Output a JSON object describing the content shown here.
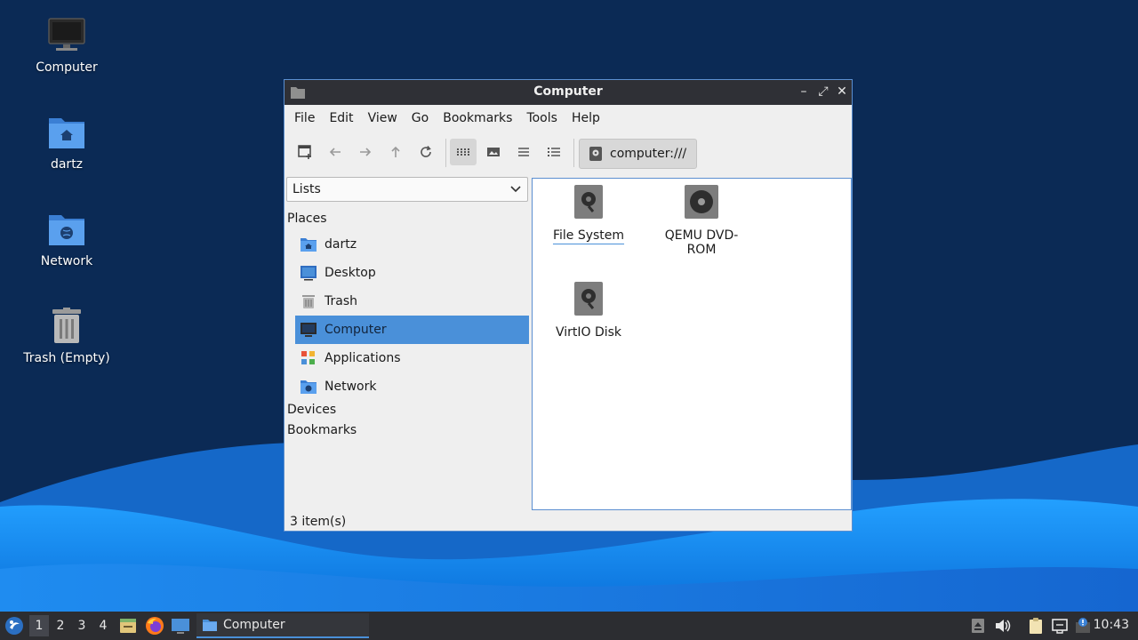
{
  "desktop": {
    "icons": [
      {
        "label": "Computer"
      },
      {
        "label": "dartz"
      },
      {
        "label": "Network"
      },
      {
        "label": "Trash (Empty)"
      }
    ]
  },
  "window": {
    "title": "Computer",
    "controls": {
      "minimize": "–",
      "maximize": "⤢",
      "close": "✕"
    },
    "menu": [
      "File",
      "Edit",
      "View",
      "Go",
      "Bookmarks",
      "Tools",
      "Help"
    ],
    "location": "computer:///",
    "sidepane": {
      "selector": "Lists",
      "places_header": "Places",
      "places": [
        {
          "label": "dartz",
          "icon": "home-folder-icon"
        },
        {
          "label": "Desktop",
          "icon": "desktop-icon"
        },
        {
          "label": "Trash",
          "icon": "trash-icon"
        },
        {
          "label": "Computer",
          "icon": "computer-icon",
          "selected": true
        },
        {
          "label": "Applications",
          "icon": "applications-icon"
        },
        {
          "label": "Network",
          "icon": "network-folder-icon"
        }
      ],
      "devices_header": "Devices",
      "bookmarks_header": "Bookmarks"
    },
    "files": [
      {
        "label": "File System",
        "icon": "drive-icon"
      },
      {
        "label": "QEMU DVD-ROM",
        "icon": "optical-drive-icon"
      },
      {
        "label": "VirtIO Disk",
        "icon": "drive-icon"
      }
    ],
    "status": "3 item(s)"
  },
  "taskbar": {
    "workspaces": [
      "1",
      "2",
      "3",
      "4"
    ],
    "current_workspace": "1",
    "task": "Computer",
    "clock": "10:43"
  },
  "colors": {
    "accent": "#4a90d9",
    "titlebar": "#2f3036",
    "taskbar": "#2c2d31",
    "wallpaper_dark": "#0b2a55",
    "wallpaper_wave": "#1e90ff"
  }
}
